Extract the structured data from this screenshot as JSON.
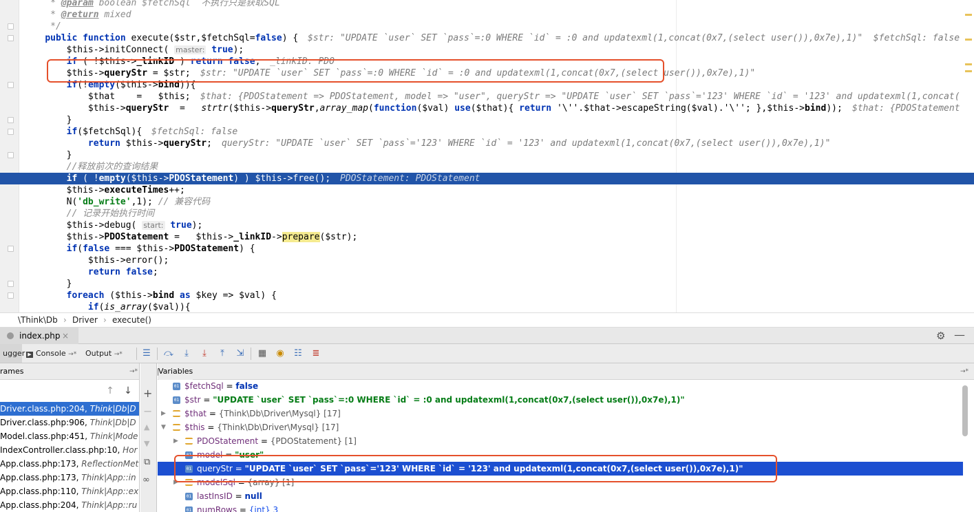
{
  "editor": {
    "lines": [
      {
        "segments": [
          {
            "t": "     * ",
            "c": "#8c8c8c",
            "i": true
          },
          {
            "t": "@param",
            "c": "#8c8c8c",
            "i": true,
            "b": true,
            "u": true
          },
          {
            "t": " boolean $fetchSql  不执行只是获取SQL",
            "c": "#8c8c8c",
            "i": true
          }
        ],
        "hint": ""
      },
      {
        "segments": [
          {
            "t": "     * ",
            "c": "#8c8c8c",
            "i": true
          },
          {
            "t": "@return",
            "c": "#8c8c8c",
            "i": true,
            "b": true,
            "u": true
          },
          {
            "t": " mixed",
            "c": "#8c8c8c",
            "i": true
          }
        ],
        "hint": ""
      },
      {
        "segments": [
          {
            "t": "     */",
            "c": "#8c8c8c",
            "i": true
          }
        ],
        "hint": ""
      },
      {
        "segments": [
          {
            "t": "    ",
            "c": "#000"
          },
          {
            "t": "public function",
            "c": "#0033b3",
            "b": true
          },
          {
            "t": " execute($str,$fetchSql=",
            "c": "#000"
          },
          {
            "t": "false",
            "c": "#0033b3",
            "b": true
          },
          {
            "t": ") {",
            "c": "#000"
          }
        ],
        "hint": "$str: \"UPDATE `user` SET `pass`=:0 WHERE `id` = :0 and updatexml(1,concat(0x7,(select user()),0x7e),1)\"  $fetchSql: false"
      },
      {
        "segments": [
          {
            "t": "        $this->initConnect( ",
            "c": "#000"
          },
          {
            "t": "master:",
            "c": "#7b7b7b",
            "s": 11
          },
          {
            "t": " ",
            "c": "#000"
          },
          {
            "t": "true",
            "c": "#0033b3",
            "b": true
          },
          {
            "t": ");",
            "c": "#000"
          }
        ],
        "hint": ""
      },
      {
        "segments": [
          {
            "t": "        ",
            "c": "#000"
          },
          {
            "t": "if",
            "c": "#0033b3",
            "b": true
          },
          {
            "t": " ( !$this->",
            "c": "#000"
          },
          {
            "t": "_linkID",
            "c": "#000",
            "b": true
          },
          {
            "t": " ) ",
            "c": "#000"
          },
          {
            "t": "return false",
            "c": "#0033b3",
            "b": true
          },
          {
            "t": ";",
            "c": "#000"
          }
        ],
        "hint": "_linkID: PDO"
      },
      {
        "segments": [
          {
            "t": "        $this->",
            "c": "#000"
          },
          {
            "t": "queryStr",
            "c": "#000",
            "b": true
          },
          {
            "t": " = $str;",
            "c": "#000"
          }
        ],
        "hint": "$str: \"UPDATE `user` SET `pass`=:0 WHERE `id` = :0 and updatexml(1,concat(0x7,(select user()),0x7e),1)\""
      },
      {
        "segments": [
          {
            "t": "        ",
            "c": "#000"
          },
          {
            "t": "if",
            "c": "#0033b3",
            "b": true
          },
          {
            "t": "(!",
            "c": "#000"
          },
          {
            "t": "empty",
            "c": "#0033b3",
            "b": true
          },
          {
            "t": "($this->",
            "c": "#000"
          },
          {
            "t": "bind",
            "c": "#000",
            "b": true
          },
          {
            "t": ")){",
            "c": "#000"
          }
        ],
        "hint": ""
      },
      {
        "segments": [
          {
            "t": "            $that    =   $this;",
            "c": "#000"
          }
        ],
        "hint": "$that: {PDOStatement => PDOStatement, model => \"user\", queryStr => \"UPDATE `user` SET `pass`='123' WHERE `id` = '123' and updatexml(1,concat("
      },
      {
        "segments": [
          {
            "t": "            $this->",
            "c": "#000"
          },
          {
            "t": "queryStr",
            "c": "#000",
            "b": true
          },
          {
            "t": "  =   ",
            "c": "#000"
          },
          {
            "t": "strtr",
            "c": "#000",
            "i": true
          },
          {
            "t": "($this->",
            "c": "#000"
          },
          {
            "t": "queryStr",
            "c": "#000",
            "b": true
          },
          {
            "t": ",",
            "c": "#000"
          },
          {
            "t": "array_map",
            "c": "#000",
            "i": true
          },
          {
            "t": "(",
            "c": "#000"
          },
          {
            "t": "function",
            "c": "#0033b3",
            "b": true
          },
          {
            "t": "($val) ",
            "c": "#000"
          },
          {
            "t": "use",
            "c": "#0033b3",
            "b": true
          },
          {
            "t": "($that){ ",
            "c": "#000"
          },
          {
            "t": "return",
            "c": "#0033b3",
            "b": true
          },
          {
            "t": " '\\''.$that->escapeString($val).'\\''; },$this->",
            "c": "#000"
          },
          {
            "t": "bind",
            "c": "#000",
            "b": true
          },
          {
            "t": "));",
            "c": "#000"
          }
        ],
        "hint": "$that: {PDOStatement"
      },
      {
        "segments": [
          {
            "t": "        }",
            "c": "#000"
          }
        ],
        "hint": ""
      },
      {
        "segments": [
          {
            "t": "        ",
            "c": "#000"
          },
          {
            "t": "if",
            "c": "#0033b3",
            "b": true
          },
          {
            "t": "($fetchSql){",
            "c": "#000"
          }
        ],
        "hint": "$fetchSql: false"
      },
      {
        "segments": [
          {
            "t": "            ",
            "c": "#000"
          },
          {
            "t": "return",
            "c": "#0033b3",
            "b": true
          },
          {
            "t": " $this->",
            "c": "#000"
          },
          {
            "t": "queryStr",
            "c": "#000",
            "b": true
          },
          {
            "t": ";",
            "c": "#000"
          }
        ],
        "hint": "queryStr: \"UPDATE `user` SET `pass`='123' WHERE `id` = '123' and updatexml(1,concat(0x7,(select user()),0x7e),1)\""
      },
      {
        "segments": [
          {
            "t": "        }",
            "c": "#000"
          }
        ],
        "hint": ""
      },
      {
        "segments": [
          {
            "t": "        //释放前次的查询结果",
            "c": "#8c8c8c",
            "i": true
          }
        ],
        "hint": ""
      },
      {
        "segments": [
          {
            "t": "        ",
            "c": "#fff"
          },
          {
            "t": "if",
            "c": "#fff",
            "b": true
          },
          {
            "t": " ( !",
            "c": "#fff"
          },
          {
            "t": "empty",
            "c": "#fff",
            "b": true
          },
          {
            "t": "($this->",
            "c": "#fff"
          },
          {
            "t": "PDOStatement",
            "c": "#fff",
            "b": true
          },
          {
            "t": ") ) $this->free();",
            "c": "#fff"
          }
        ],
        "hint": "PDOStatement: PDOStatement"
      },
      {
        "segments": [
          {
            "t": "        $this->",
            "c": "#000"
          },
          {
            "t": "executeTimes",
            "c": "#000",
            "b": true
          },
          {
            "t": "++;",
            "c": "#000"
          }
        ],
        "hint": ""
      },
      {
        "segments": [
          {
            "t": "        N(",
            "c": "#000"
          },
          {
            "t": "'db_write'",
            "c": "#067d17",
            "b": true
          },
          {
            "t": ",1); ",
            "c": "#000"
          },
          {
            "t": "// 兼容代码",
            "c": "#8c8c8c",
            "i": true
          }
        ],
        "hint": ""
      },
      {
        "segments": [
          {
            "t": "        // 记录开始执行时间",
            "c": "#8c8c8c",
            "i": true
          }
        ],
        "hint": ""
      },
      {
        "segments": [
          {
            "t": "        $this->debug( ",
            "c": "#000"
          },
          {
            "t": "start:",
            "c": "#7b7b7b",
            "s": 11
          },
          {
            "t": " ",
            "c": "#000"
          },
          {
            "t": "true",
            "c": "#0033b3",
            "b": true
          },
          {
            "t": ");",
            "c": "#000"
          }
        ],
        "hint": ""
      },
      {
        "segments": [
          {
            "t": "        $this->",
            "c": "#000"
          },
          {
            "t": "PDOStatement",
            "c": "#000",
            "b": true
          },
          {
            "t": " =   $this->",
            "c": "#000"
          },
          {
            "t": "_linkID",
            "c": "#000",
            "b": true
          },
          {
            "t": "->",
            "c": "#000"
          },
          {
            "t": "prepare",
            "c": "#000",
            "bg": "#f5eb90"
          },
          {
            "t": "($str);",
            "c": "#000"
          }
        ],
        "hint": ""
      },
      {
        "segments": [
          {
            "t": "        ",
            "c": "#000"
          },
          {
            "t": "if",
            "c": "#0033b3",
            "b": true
          },
          {
            "t": "(",
            "c": "#000"
          },
          {
            "t": "false",
            "c": "#0033b3",
            "b": true
          },
          {
            "t": " === $this->",
            "c": "#000"
          },
          {
            "t": "PDOStatement",
            "c": "#000",
            "b": true
          },
          {
            "t": ") {",
            "c": "#000"
          }
        ],
        "hint": ""
      },
      {
        "segments": [
          {
            "t": "            $this->error();",
            "c": "#000"
          }
        ],
        "hint": ""
      },
      {
        "segments": [
          {
            "t": "            ",
            "c": "#000"
          },
          {
            "t": "return false",
            "c": "#0033b3",
            "b": true
          },
          {
            "t": ";",
            "c": "#000"
          }
        ],
        "hint": ""
      },
      {
        "segments": [
          {
            "t": "        }",
            "c": "#000"
          }
        ],
        "hint": ""
      },
      {
        "segments": [
          {
            "t": "        ",
            "c": "#000"
          },
          {
            "t": "foreach",
            "c": "#0033b3",
            "b": true
          },
          {
            "t": " ($this->",
            "c": "#000"
          },
          {
            "t": "bind",
            "c": "#000",
            "b": true
          },
          {
            "t": " ",
            "c": "#000"
          },
          {
            "t": "as",
            "c": "#0033b3",
            "b": true
          },
          {
            "t": " $key => $val) {",
            "c": "#000"
          }
        ],
        "hint": ""
      },
      {
        "segments": [
          {
            "t": "            ",
            "c": "#000"
          },
          {
            "t": "if",
            "c": "#0033b3",
            "b": true
          },
          {
            "t": "(",
            "c": "#000"
          },
          {
            "t": "is_array",
            "c": "#000",
            "i": true
          },
          {
            "t": "($val)){",
            "c": "#000"
          }
        ],
        "hint": ""
      }
    ],
    "execution_line_index": 15
  },
  "breadcrumb": [
    "\\Think\\Db",
    "Driver",
    "execute()"
  ],
  "file_tab": {
    "label": "index.php",
    "close": "×"
  },
  "debugger": {
    "tabs": [
      {
        "label": "ugger"
      },
      {
        "label": "Console",
        "pin": "→*"
      },
      {
        "label": "Output",
        "pin": "→*"
      }
    ],
    "frames_header": "rames",
    "variables_header": "Variables",
    "frames": [
      {
        "file": "Driver.class.php:204,",
        "cls": "Think|Db|D"
      },
      {
        "file": "Driver.class.php:906,",
        "cls": "Think|Db|D"
      },
      {
        "file": "Model.class.php:451,",
        "cls": "Think|Mode"
      },
      {
        "file": "IndexController.class.php:10,",
        "cls": "Hor"
      },
      {
        "file": "App.class.php:173,",
        "cls": "ReflectionMet"
      },
      {
        "file": "App.class.php:173,",
        "cls": "Think|App::in"
      },
      {
        "file": "App.class.php:110,",
        "cls": "Think|App::ex"
      },
      {
        "file": "App.class.php:204,",
        "cls": "Think|App::ru"
      }
    ],
    "selected_frame": 0,
    "variables": [
      {
        "indent": 0,
        "arrow": "",
        "icon": "01",
        "name": "$fetchSql",
        "value": "false",
        "kind": "kw"
      },
      {
        "indent": 0,
        "arrow": "",
        "icon": "01",
        "name": "$str",
        "value": "\"UPDATE `user` SET `pass`=:0 WHERE `id` = :0 and updatexml(1,concat(0x7,(select user()),0x7e),1)\"",
        "kind": "str"
      },
      {
        "indent": 0,
        "arrow": "▶",
        "icon": "arr",
        "name": "$that",
        "value": "{Think\\Db\\Driver\\Mysql} [17]",
        "kind": "typ"
      },
      {
        "indent": 0,
        "arrow": "▼",
        "icon": "arr",
        "name": "$this",
        "value": "{Think\\Db\\Driver\\Mysql} [17]",
        "kind": "typ"
      },
      {
        "indent": 1,
        "arrow": "▶",
        "icon": "arr",
        "name": "PDOStatement",
        "value": "{PDOStatement} [1]",
        "kind": "typ"
      },
      {
        "indent": 1,
        "arrow": "",
        "icon": "01",
        "name": "model",
        "value": "\"user\"",
        "kind": "str"
      },
      {
        "indent": 1,
        "arrow": "",
        "icon": "01",
        "name": "queryStr",
        "value": "\"UPDATE `user` SET `pass`='123' WHERE `id` = '123' and updatexml(1,concat(0x7,(select user()),0x7e),1)\"",
        "kind": "str"
      },
      {
        "indent": 1,
        "arrow": "▶",
        "icon": "arr",
        "name": "modelSql",
        "value": "{array} [1]",
        "kind": "typ"
      },
      {
        "indent": 1,
        "arrow": "",
        "icon": "01",
        "name": "lastInsID",
        "value": "null",
        "kind": "kw"
      },
      {
        "indent": 1,
        "arrow": "",
        "icon": "01",
        "name": "numRows",
        "value": "{int} 3",
        "kind": "num"
      }
    ],
    "selected_variable": 6
  },
  "icons": {
    "settings": "gear-icon",
    "minimize": "minimize-icon"
  },
  "colors": {
    "execution_line": "#2154a8",
    "selected_row": "#1c4fd1",
    "annotation_box": "#e5502b",
    "keyword": "#0033b3",
    "string": "#067d17"
  }
}
